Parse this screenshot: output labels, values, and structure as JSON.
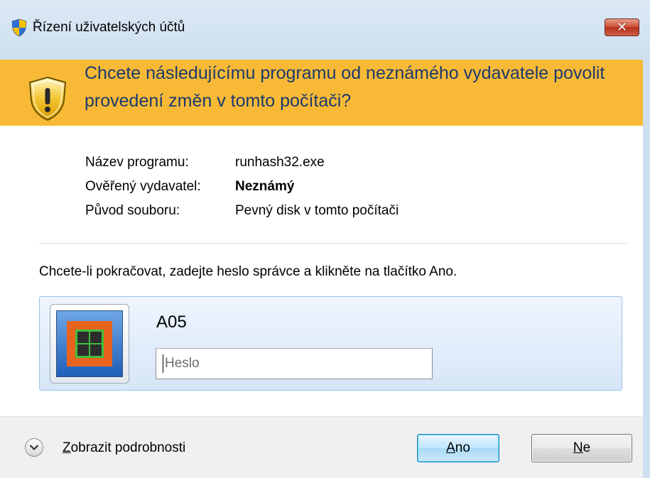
{
  "window": {
    "title": "Řízení uživatelských účtů",
    "close_label": "✕"
  },
  "banner": {
    "question": "Chcete následujícímu programu od neznámého vydavatele povolit provedení změn v tomto počítači?"
  },
  "info": [
    {
      "label": "Název programu:",
      "value": "runhash32.exe",
      "bold": false
    },
    {
      "label": "Ověřený vydavatel:",
      "value": "Neznámý",
      "bold": true
    },
    {
      "label": "Původ souboru:",
      "value": "Pevný disk v tomto počítači",
      "bold": false
    }
  ],
  "instruction": "Chcete-li pokračovat, zadejte heslo správce a klikněte na tlačítko Ano.",
  "credential": {
    "user_name": "A05",
    "password_placeholder": "Heslo",
    "password_value": ""
  },
  "footer": {
    "details_label_accel": "Z",
    "details_label_rest": "obrazit podrobnosti",
    "yes_accel": "A",
    "yes_rest": "no",
    "no_accel": "N",
    "no_rest": "e"
  },
  "colors": {
    "banner": "#f8ba36",
    "banner_text": "#1b3a6e",
    "titlebar": "#cddff0"
  },
  "icons": {
    "title": "uac-shield-icon",
    "banner": "warning-shield-icon",
    "toggle": "chevron-down-circle-icon",
    "close": "close-icon"
  }
}
